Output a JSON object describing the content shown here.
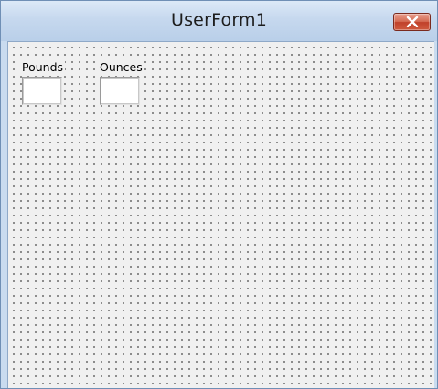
{
  "window": {
    "title": "UserForm1"
  },
  "icons": {
    "close": "close-icon"
  },
  "colors": {
    "titlebar": "#c6d8ee",
    "close_button": "#c9553b",
    "form_background": "#f0f0f0",
    "grid_dots": "#4a4a4a"
  },
  "form": {
    "pounds_label": "Pounds",
    "ounces_label": "Ounces",
    "pounds_value": "",
    "ounces_value": ""
  }
}
